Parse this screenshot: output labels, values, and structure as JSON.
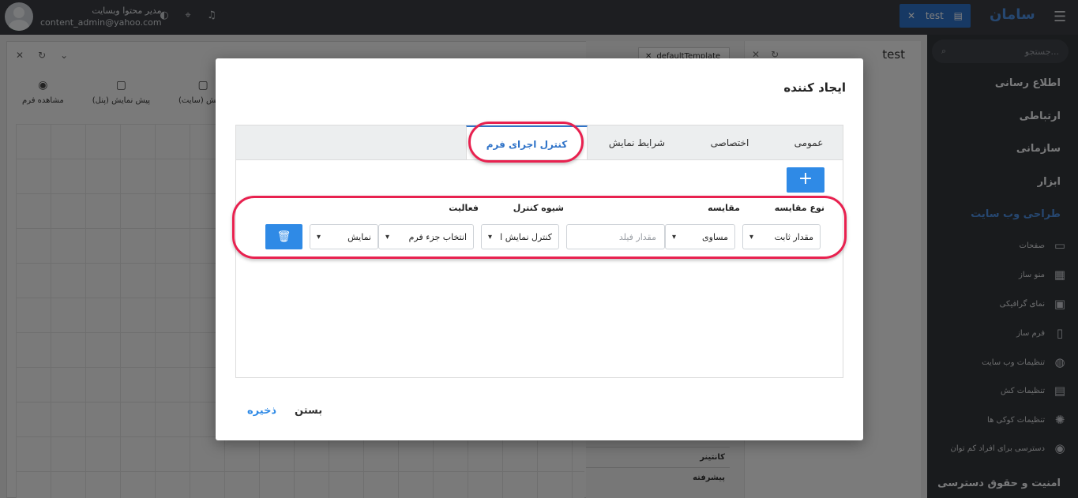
{
  "header": {
    "user_name": "مدیر محتوا وبسایت",
    "user_email": "content_admin@yahoo.com",
    "app_tab_label": "test",
    "brand": "سامان"
  },
  "sidebar": {
    "search_placeholder": "جستجو...",
    "groups": [
      "اطلاع رسانی",
      "ارتباطی",
      "سازمانی",
      "ابزار",
      "طراحی وب سایت",
      "امنیت و حقوق دسترسی"
    ],
    "sub_items": [
      "صفحات",
      "منو ساز",
      "نمای گرافیکی",
      "فرم ساز",
      "تنظیمات وب سایت",
      "تنظیمات کش",
      "تنظیمات کوکی ها",
      "دسترسی برای افراد کم توان"
    ]
  },
  "background": {
    "actions": [
      "مشاهده فرم",
      "پیش نمایش (پنل)",
      "نمایش (سایت)"
    ],
    "template_tab": "defaultTemplate",
    "panel_title": "test",
    "mid_items": [
      "کانتینر",
      "پیشرفته"
    ],
    "tree_label": "test"
  },
  "modal": {
    "title": "ایجاد کننده",
    "tabs": [
      "عمومی",
      "اختصاصی",
      "شرایط نمایش",
      "کنترل اجرای فرم"
    ],
    "active_tab": "کنترل اجرای فرم",
    "add_label": "+",
    "columns": {
      "compare_type": "نوع مقایسه",
      "compare": "مقایسه",
      "control_mode": "شیوه کنترل",
      "action": "فعالیت"
    },
    "row": {
      "compare_type_value": "مقدار ثابت",
      "compare_value": "مساوی",
      "field_placeholder": "مقدار فیلد",
      "control_mode_value": "کنترل نمایش ا",
      "element_value": "انتخاب جزء فرم",
      "action_value": "نمایش"
    },
    "close_label": "بستن",
    "save_label": "ذخیره"
  },
  "colors": {
    "accent": "#2f8ae6",
    "highlight": "#e8214f",
    "sidebar_bg": "#33363b",
    "topbar_bg": "#3a3d42"
  }
}
